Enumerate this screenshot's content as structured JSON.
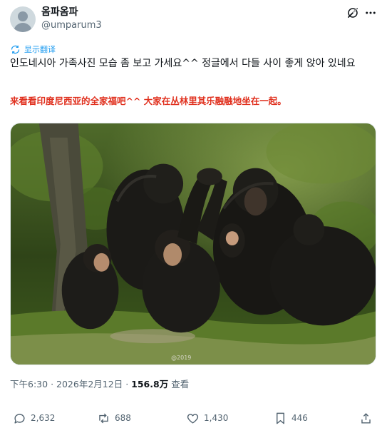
{
  "post": {
    "author": {
      "display_name": "옴파옴파",
      "handle": "@umparum3"
    },
    "translate_label": "显示翻译",
    "text": "인도네시아 가족사진 모습 좀 보고 가세요^^ 정글에서 다들 사이 좋게 앉아 있네요",
    "translated_text": "来看看印度尼西亚的全家福吧^^ 大家在丛林里其乐融融地坐在一起。",
    "media": {
      "alt_icon": "chimpanzee-family-photo",
      "watermark": "@2019"
    },
    "meta": {
      "time": "下午6:30",
      "separator": "·",
      "date": "2026年2月12日",
      "views": "156.8万",
      "views_label": "查看"
    },
    "stats": {
      "replies": "2,632",
      "reposts": "688",
      "likes": "1,430",
      "bookmarks": "446"
    }
  },
  "colors": {
    "accent": "#1d9bf0",
    "translated_text": "#e0301e",
    "muted": "#536471"
  },
  "icons": [
    "grok-icon",
    "more-icon",
    "translate-icon",
    "reply-icon",
    "repost-icon",
    "like-icon",
    "bookmark-icon",
    "share-icon"
  ]
}
